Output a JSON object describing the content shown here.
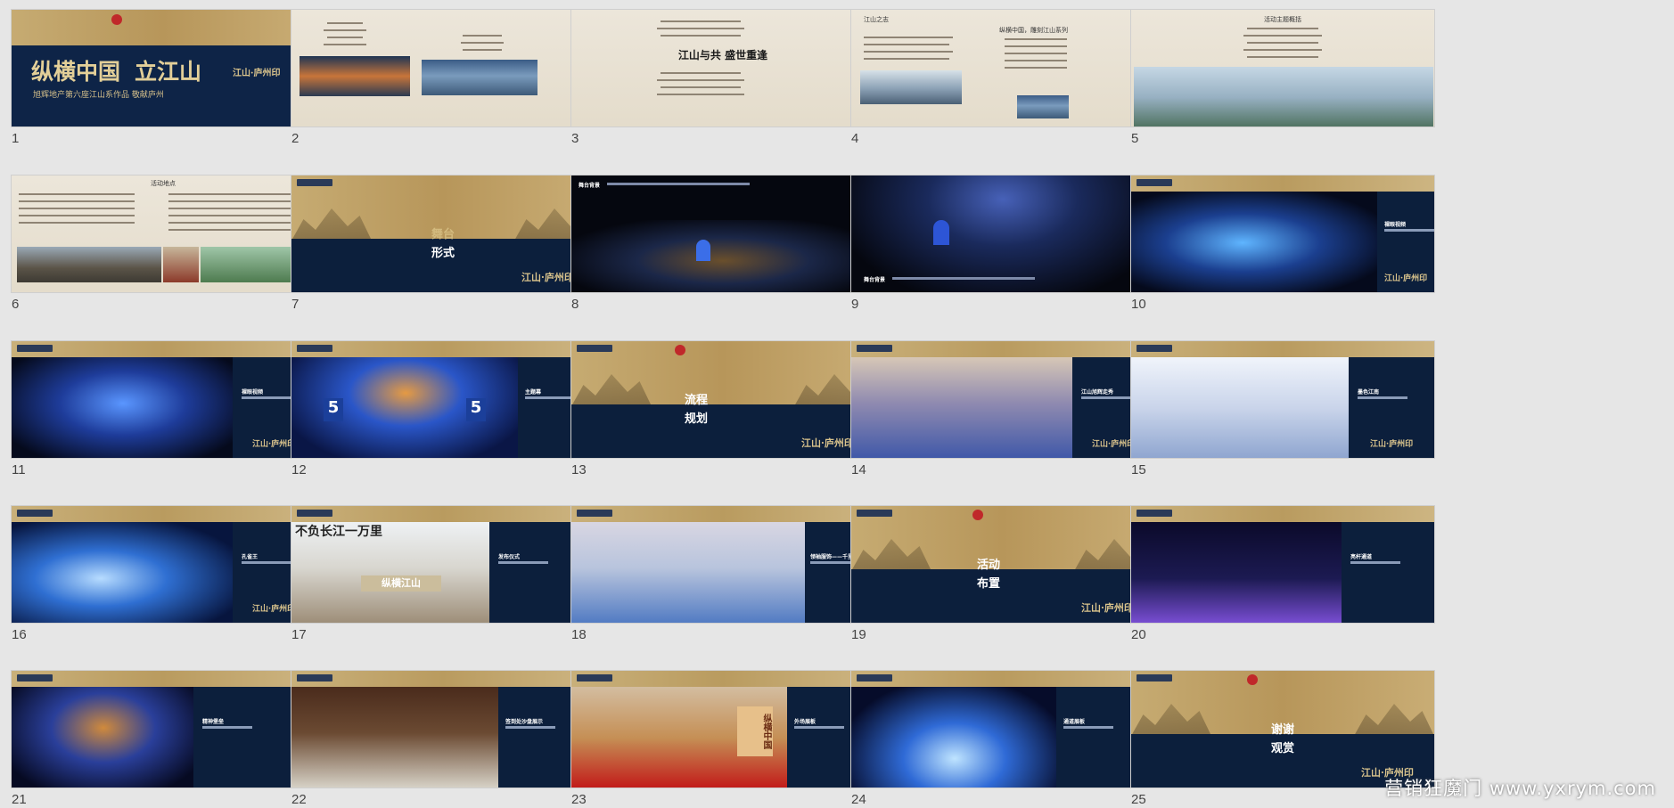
{
  "window": {
    "watermark": "营销狂魔门 www.yxrym.com"
  },
  "slides": [
    {
      "n": "1",
      "title_a": "纵横中国",
      "title_b": "立江山",
      "subtitle": "旭辉地产第六座江山系作品 敬献庐州",
      "brand": "江山·庐州印"
    },
    {
      "n": "2"
    },
    {
      "n": "3",
      "calligraphy": "江山与共 盛世重逢"
    },
    {
      "n": "4",
      "heading_left": "江山之志",
      "heading_right": "纵横中国，雕刻江山系列"
    },
    {
      "n": "5",
      "heading": "活动主题概括"
    },
    {
      "n": "6",
      "heading": "活动地点"
    },
    {
      "n": "7",
      "title_top": "舞台",
      "title_bottom": "形式",
      "brand": "江山·庐州印"
    },
    {
      "n": "8",
      "caption": "舞台背景"
    },
    {
      "n": "9",
      "caption": "舞台背景"
    },
    {
      "n": "10",
      "caption": "裸眼视频"
    },
    {
      "n": "11",
      "caption": "裸眼视频"
    },
    {
      "n": "12",
      "caption": "主题幕",
      "badge_left": "5",
      "badge_right": "5"
    },
    {
      "n": "13",
      "title_top": "流程",
      "title_bottom": "规划",
      "brand": "江山·庐州印"
    },
    {
      "n": "14",
      "caption": "江山旭辉走秀"
    },
    {
      "n": "15",
      "caption": "墨色江南"
    },
    {
      "n": "16",
      "caption": "孔雀王"
    },
    {
      "n": "17",
      "caption": "发布仪式",
      "banner": "不负长江一万里",
      "stage_text": "纵横江山"
    },
    {
      "n": "18",
      "caption": "领袖服饰——千里江山图"
    },
    {
      "n": "19",
      "title_top": "活动",
      "title_bottom": "布置",
      "brand": "江山·庐州印"
    },
    {
      "n": "20",
      "caption": "亮杆通道"
    },
    {
      "n": "21",
      "caption": "精神堡垒"
    },
    {
      "n": "22",
      "caption": "签到处沙盘展示"
    },
    {
      "n": "23",
      "caption": "外场展板",
      "panel_text": "纵横中国"
    },
    {
      "n": "24",
      "caption": "通道展板"
    },
    {
      "n": "25",
      "title_top": "谢谢",
      "title_bottom": "观赏",
      "brand": "江山·庐州印"
    }
  ]
}
